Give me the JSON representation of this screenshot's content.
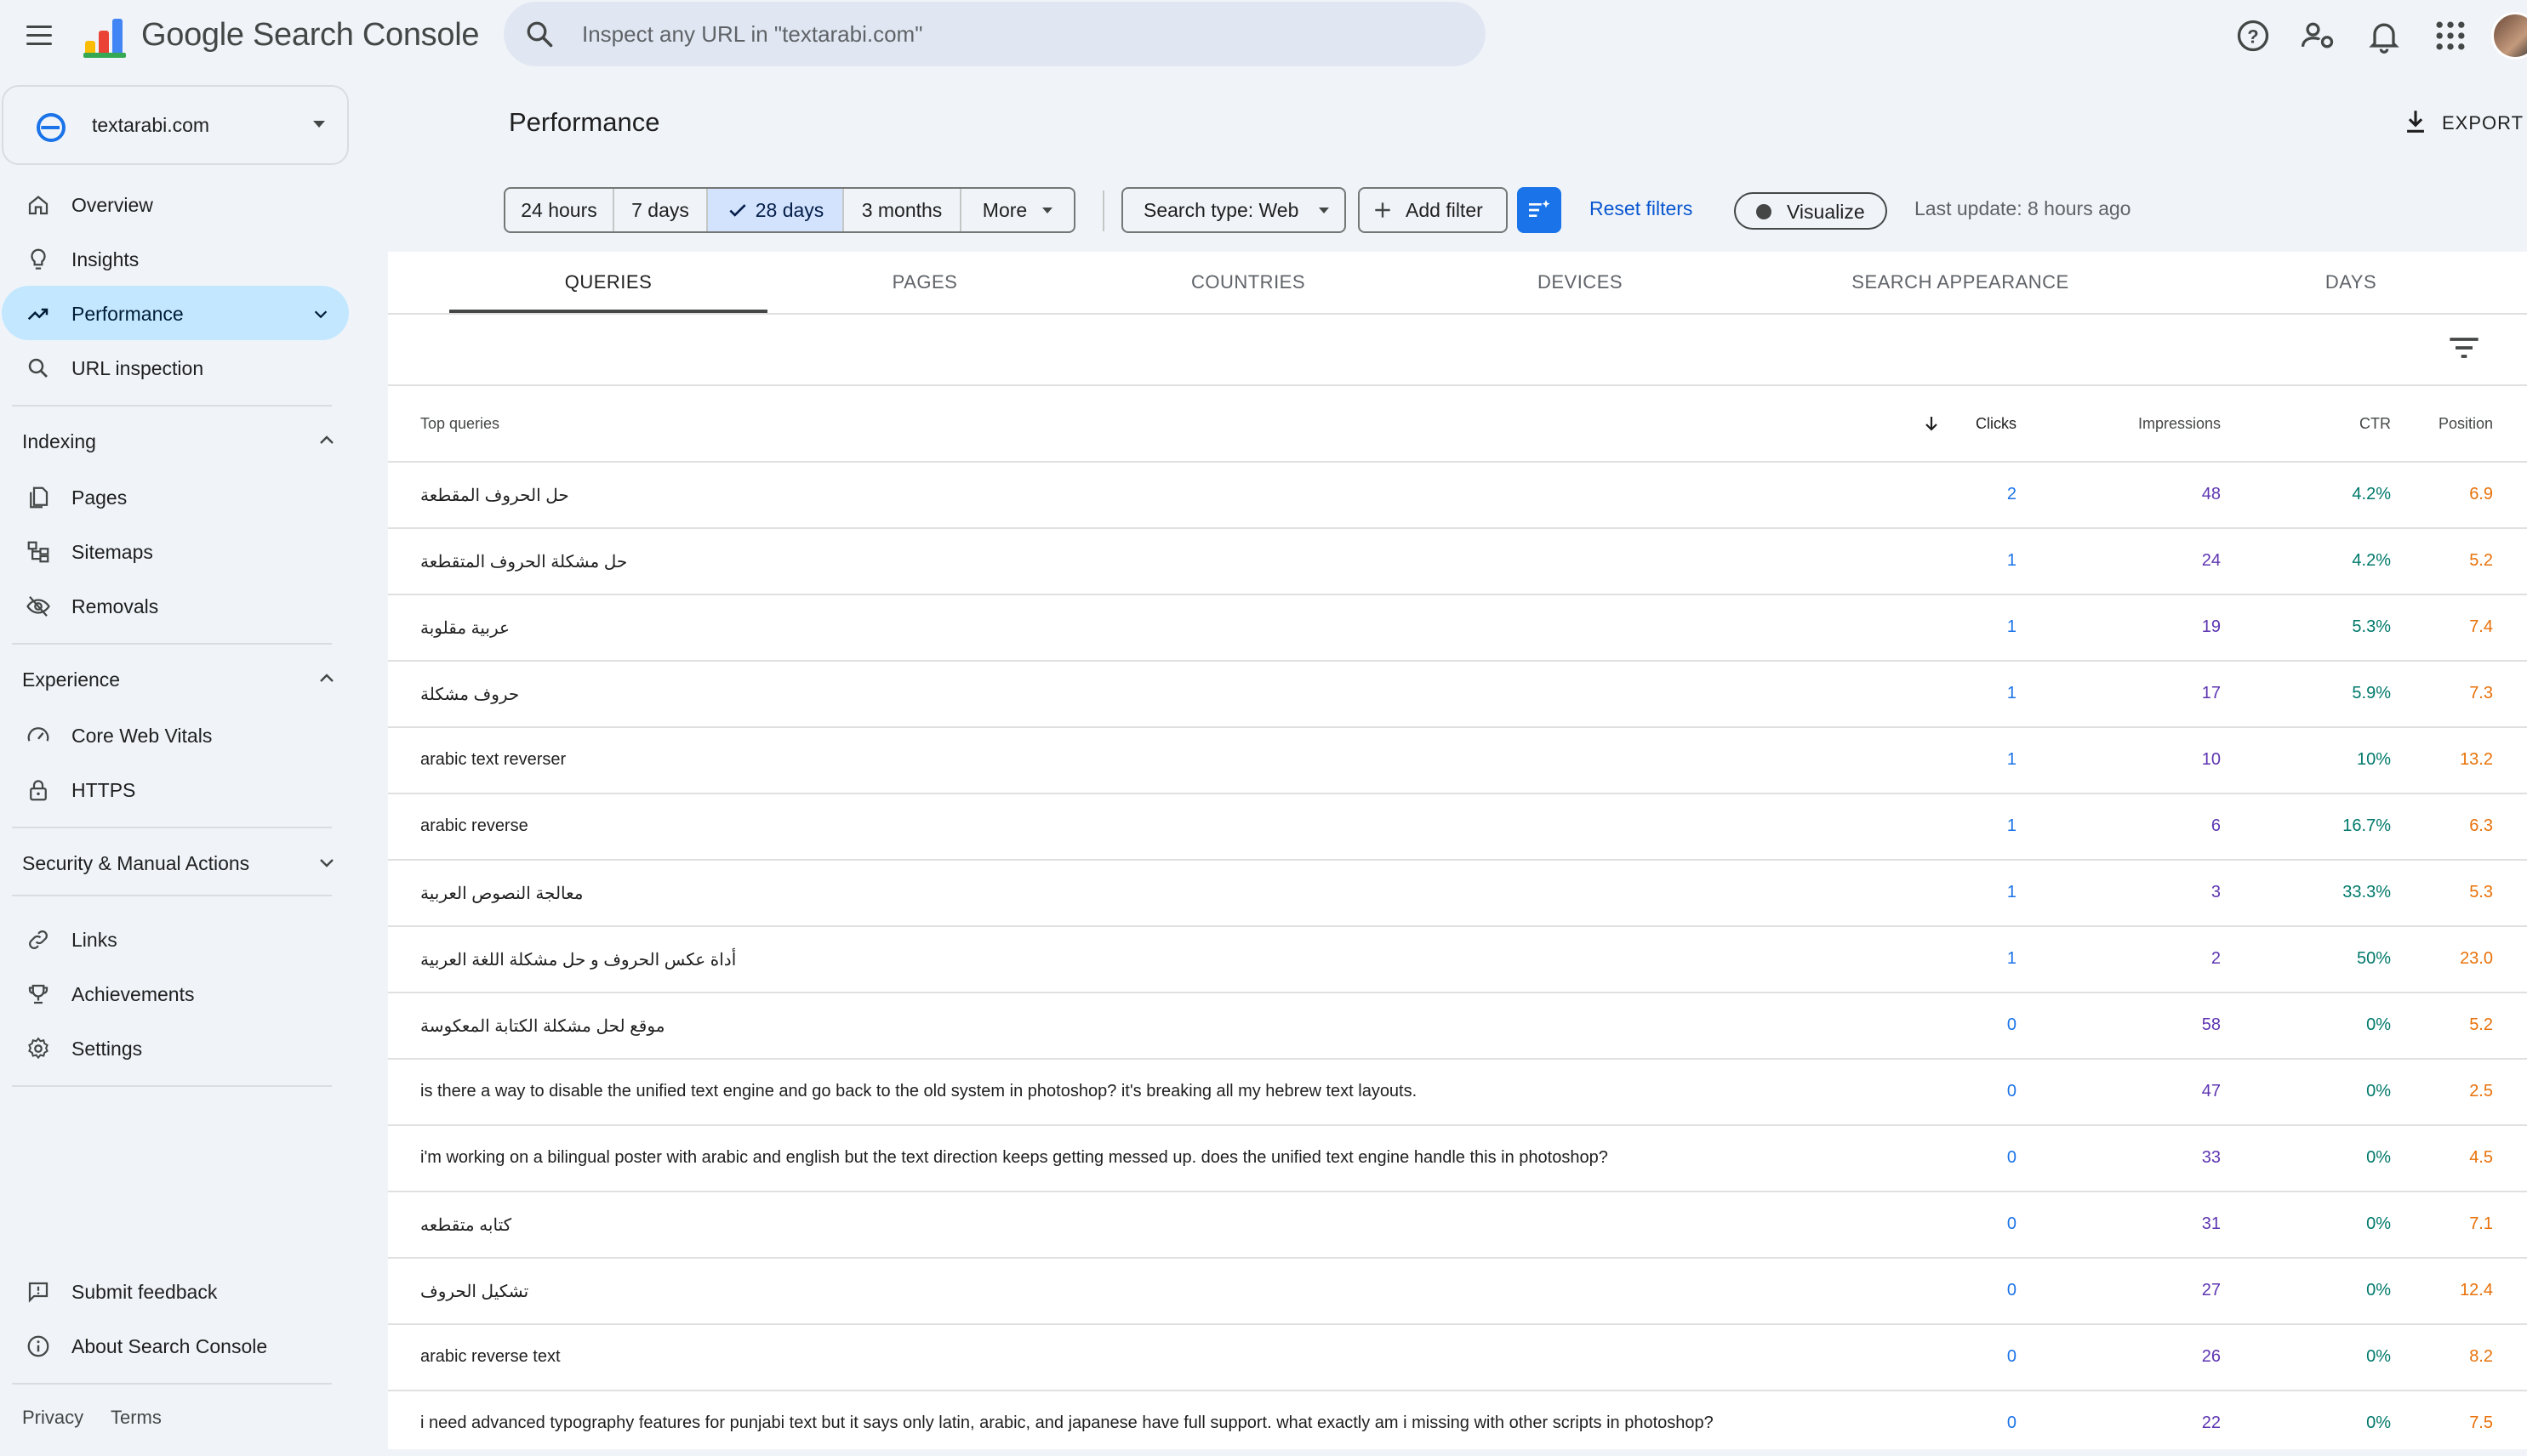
{
  "app": {
    "title": "Google Search Console"
  },
  "search": {
    "placeholder": "Inspect any URL in \"textarabi.com\""
  },
  "property": {
    "name": "textarabi.com"
  },
  "sidebar": {
    "nav": [
      {
        "label": "Overview"
      },
      {
        "label": "Insights"
      },
      {
        "label": "Performance"
      },
      {
        "label": "URL inspection"
      }
    ],
    "indexing": {
      "heading": "Indexing",
      "items": [
        {
          "label": "Pages"
        },
        {
          "label": "Sitemaps"
        },
        {
          "label": "Removals"
        }
      ]
    },
    "experience": {
      "heading": "Experience",
      "items": [
        {
          "label": "Core Web Vitals"
        },
        {
          "label": "HTTPS"
        }
      ]
    },
    "security": {
      "heading": "Security & Manual Actions"
    },
    "more": [
      {
        "label": "Links"
      },
      {
        "label": "Achievements"
      },
      {
        "label": "Settings"
      }
    ],
    "bottom": [
      {
        "label": "Submit feedback"
      },
      {
        "label": "About Search Console"
      }
    ],
    "footer": {
      "privacy": "Privacy",
      "terms": "Terms"
    }
  },
  "main": {
    "title": "Performance",
    "export_label": "EXPORT",
    "date_ranges": [
      "24 hours",
      "7 days",
      "28 days",
      "3 months",
      "More"
    ],
    "selected_range": "28 days",
    "search_type": "Search type: Web",
    "add_filter": "Add filter",
    "reset_filters": "Reset filters",
    "visualize": "Visualize",
    "last_update": "Last update: 8 hours ago",
    "tabs": [
      "QUERIES",
      "PAGES",
      "COUNTRIES",
      "DEVICES",
      "SEARCH APPEARANCE",
      "DAYS"
    ],
    "active_tab": "QUERIES"
  },
  "table": {
    "columns": {
      "query": "Top queries",
      "clicks": "Clicks",
      "impressions": "Impressions",
      "ctr": "CTR",
      "position": "Position"
    },
    "sort": "Clicks descending",
    "rows": [
      {
        "query": "حل الحروف المقطعة",
        "clicks": "2",
        "impressions": "48",
        "ctr": "4.2%",
        "position": "6.9"
      },
      {
        "query": "حل مشكلة الحروف المتقطعة",
        "clicks": "1",
        "impressions": "24",
        "ctr": "4.2%",
        "position": "5.2"
      },
      {
        "query": "عربية مقلوبة",
        "clicks": "1",
        "impressions": "19",
        "ctr": "5.3%",
        "position": "7.4"
      },
      {
        "query": "حروف مشكلة",
        "clicks": "1",
        "impressions": "17",
        "ctr": "5.9%",
        "position": "7.3"
      },
      {
        "query": "arabic text reverser",
        "clicks": "1",
        "impressions": "10",
        "ctr": "10%",
        "position": "13.2"
      },
      {
        "query": "arabic reverse",
        "clicks": "1",
        "impressions": "6",
        "ctr": "16.7%",
        "position": "6.3"
      },
      {
        "query": "معالجة النصوص العربية",
        "clicks": "1",
        "impressions": "3",
        "ctr": "33.3%",
        "position": "5.3"
      },
      {
        "query": "أداة عكس الحروف و حل مشكلة اللغة العربية",
        "clicks": "1",
        "impressions": "2",
        "ctr": "50%",
        "position": "23.0"
      },
      {
        "query": "موقع لحل مشكلة الكتابة المعكوسة",
        "clicks": "0",
        "impressions": "58",
        "ctr": "0%",
        "position": "5.2"
      },
      {
        "query": "is there a way to disable the unified text engine and go back to the old system in photoshop? it's breaking all my hebrew text layouts.",
        "clicks": "0",
        "impressions": "47",
        "ctr": "0%",
        "position": "2.5"
      },
      {
        "query": "i'm working on a bilingual poster with arabic and english but the text direction keeps getting messed up. does the unified text engine handle this in photoshop?",
        "clicks": "0",
        "impressions": "33",
        "ctr": "0%",
        "position": "4.5"
      },
      {
        "query": "كتابه متقطعه",
        "clicks": "0",
        "impressions": "31",
        "ctr": "0%",
        "position": "7.1"
      },
      {
        "query": "تشكيل الحروف",
        "clicks": "0",
        "impressions": "27",
        "ctr": "0%",
        "position": "12.4"
      },
      {
        "query": "arabic reverse text",
        "clicks": "0",
        "impressions": "26",
        "ctr": "0%",
        "position": "8.2"
      },
      {
        "query": "i need advanced typography features for punjabi text but it says only latin, arabic, and japanese have full support. what exactly am i missing with other scripts in photoshop?",
        "clicks": "0",
        "impressions": "22",
        "ctr": "0%",
        "position": "7.5"
      }
    ]
  },
  "colors": {
    "accent": "#0b57d0",
    "active_nav": "#c2e7ff",
    "clicks": "#1a73e8",
    "impressions": "#5e35b1",
    "ctr": "#00796b",
    "position": "#e8710a"
  }
}
